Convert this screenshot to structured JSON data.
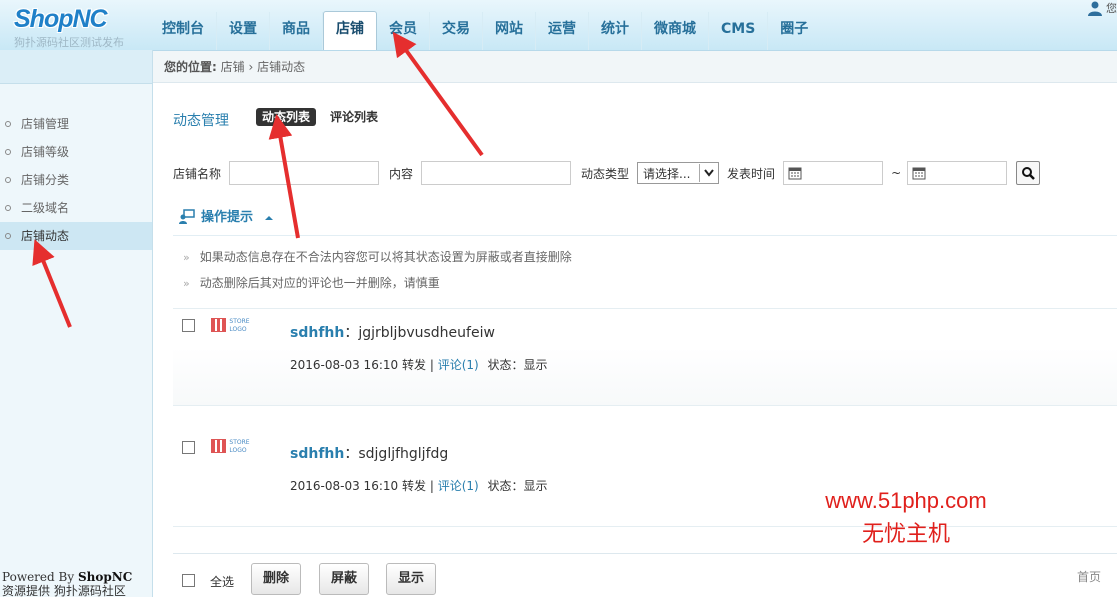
{
  "header": {
    "logo_main": "ShopNC",
    "logo_sub": "狗扑源码社区测试发布",
    "user_text": "您",
    "nav": [
      "控制台",
      "设置",
      "商品",
      "店铺",
      "会员",
      "交易",
      "网站",
      "运营",
      "统计",
      "微商城",
      "CMS",
      "圈子"
    ],
    "active_nav": "店铺"
  },
  "sidebar": {
    "items": [
      "店铺管理",
      "店铺等级",
      "店铺分类",
      "二级域名",
      "店铺动态"
    ],
    "active_item": "店铺动态",
    "powered_prefix": "Powered By ",
    "powered_brand": "ShopNC",
    "source_line": "资源提供 狗扑源码社区"
  },
  "breadcrumb": {
    "prefix": "您的位置:",
    "path1": "店铺",
    "sep": "›",
    "path2": "店铺动态"
  },
  "main": {
    "title": "动态管理",
    "tabs": [
      {
        "label": "动态列表",
        "active": true
      },
      {
        "label": "评论列表",
        "active": false
      }
    ],
    "search": {
      "store_label": "店铺名称",
      "content_label": "内容",
      "type_label": "动态类型",
      "type_value": "请选择...",
      "time_label": "发表时间",
      "range_sep": "~"
    },
    "tips": {
      "title": "操作提示",
      "items": [
        "如果动态信息存在不合法内容您可以将其状态设置为屏蔽或者直接删除",
        "动态删除后其对应的评论也一并删除，请慎重"
      ]
    },
    "store_logo_text": "STORE LOGO",
    "feeds": [
      {
        "user": "sdhfhh",
        "sep": "：",
        "content": "jgjrbljbvusdheufeiw",
        "time": "2016-08-03 16:10",
        "action": "转发",
        "bar": "|",
        "comment": "评论(1)",
        "status_label": "状态：",
        "status": "显示"
      },
      {
        "user": "sdhfhh",
        "sep": "：",
        "content": "sdjgljfhgljfdg",
        "time": "2016-08-03 16:10",
        "action": "转发",
        "bar": "|",
        "comment": "评论(1)",
        "status_label": "状态：",
        "status": "显示"
      }
    ],
    "footer": {
      "select_all": "全选",
      "delete": "删除",
      "block": "屏蔽",
      "show": "显示",
      "first_page": "首页"
    }
  },
  "watermark": {
    "line1": "www.51php.com",
    "line2": "无忧主机"
  },
  "colors": {
    "accent": "#2a7fae",
    "nav_text": "#27709a",
    "watermark": "#e0201c"
  }
}
